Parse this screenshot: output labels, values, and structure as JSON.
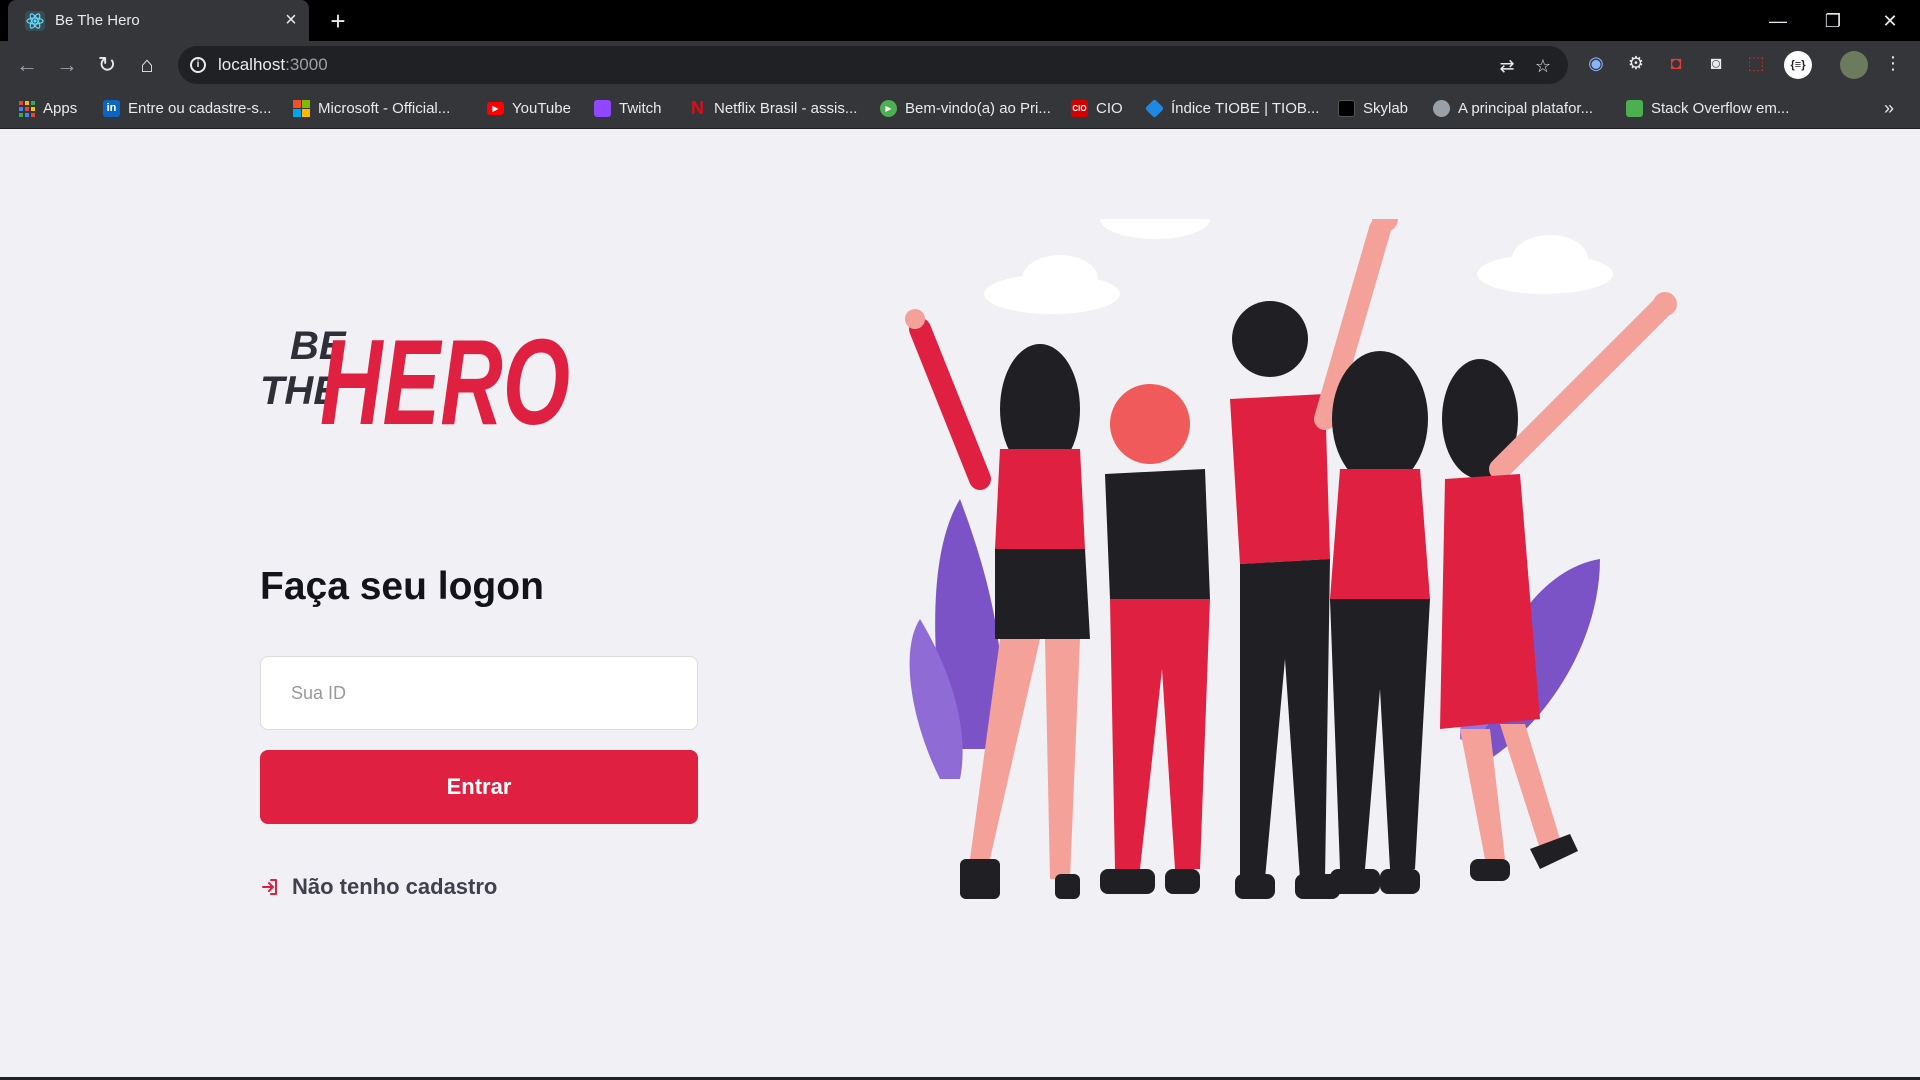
{
  "browser": {
    "tab": {
      "title": "Be The Hero",
      "favicon": "react-icon"
    },
    "url_host": "localhost",
    "url_port": ":3000",
    "bookmarks": [
      {
        "label": "Apps",
        "icon": "apps-grid-icon",
        "color": "#ea4335"
      },
      {
        "label": "Entre ou cadastre-s...",
        "icon": "linkedin-icon",
        "color": "#0a66c2"
      },
      {
        "label": "Microsoft - Official...",
        "icon": "microsoft-icon",
        "color": "#f25022"
      },
      {
        "label": "YouTube",
        "icon": "youtube-icon",
        "color": "#ff0000"
      },
      {
        "label": "Twitch",
        "icon": "twitch-icon",
        "color": "#9146ff"
      },
      {
        "label": "Netflix Brasil - assis...",
        "icon": "netflix-icon",
        "color": "#e50914"
      },
      {
        "label": "Bem-vindo(a) ao Pri...",
        "icon": "play-icon",
        "color": "#4caf50"
      },
      {
        "label": "CIO",
        "icon": "cio-icon",
        "color": "#d50000"
      },
      {
        "label": "Índice TIOBE | TIOB...",
        "icon": "tiobe-icon",
        "color": "#1e88e5"
      },
      {
        "label": "Skylab",
        "icon": "skylab-icon",
        "color": "#ffffff"
      },
      {
        "label": "A principal platafor...",
        "icon": "github-icon",
        "color": "#9aa0a6"
      },
      {
        "label": "Stack Overflow em...",
        "icon": "stackoverflow-icon",
        "color": "#4caf50"
      }
    ],
    "bookmarks_overflow": "»"
  },
  "logon": {
    "logo_line1": "BE",
    "logo_line2": "THE",
    "logo_word": "HERO",
    "title": "Faça seu logon",
    "id_placeholder": "Sua ID",
    "submit_label": "Entrar",
    "register_label": "Não tenho cadastro"
  },
  "colors": {
    "brand": "#e02041",
    "background": "#f0f0f5",
    "text_dark": "#13131a",
    "text_muted": "#41414d"
  }
}
